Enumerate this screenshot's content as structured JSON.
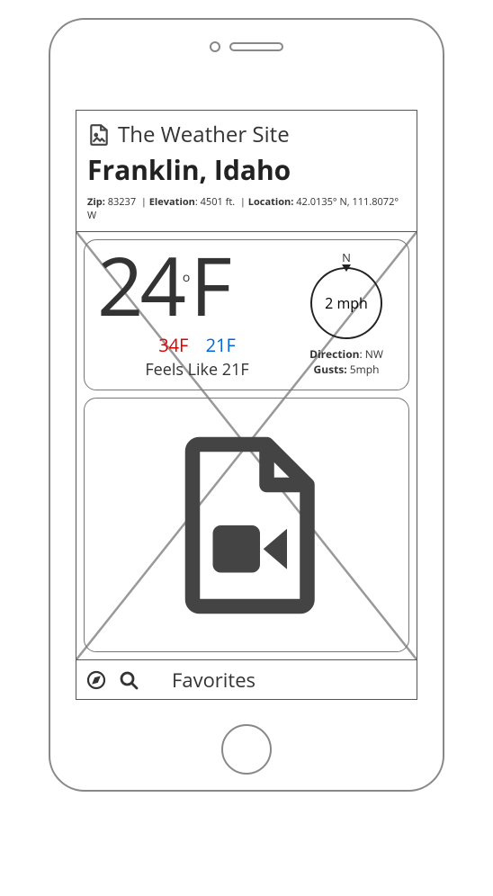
{
  "header": {
    "site_title": "The Weather Site",
    "location_title": "Franklin, Idaho",
    "zip_label": "Zip:",
    "zip_value": "83237",
    "elevation_label": "Elevation",
    "elevation_value": "4501 ft.",
    "location_label": "Location:",
    "location_value": "42.0135° N, 111.8072° W"
  },
  "current": {
    "temp_value": "24",
    "temp_deg": "o",
    "temp_unit": "F",
    "high": "34F",
    "low": "21F",
    "feels_label": "Feels Like 21F"
  },
  "wind": {
    "compass_n": "N",
    "speed": "2 mph",
    "direction_label": "Direction",
    "direction_value": "NW",
    "gusts_label": "Gusts:",
    "gusts_value": "5mph"
  },
  "bottombar": {
    "favorites_label": "Favorites"
  }
}
